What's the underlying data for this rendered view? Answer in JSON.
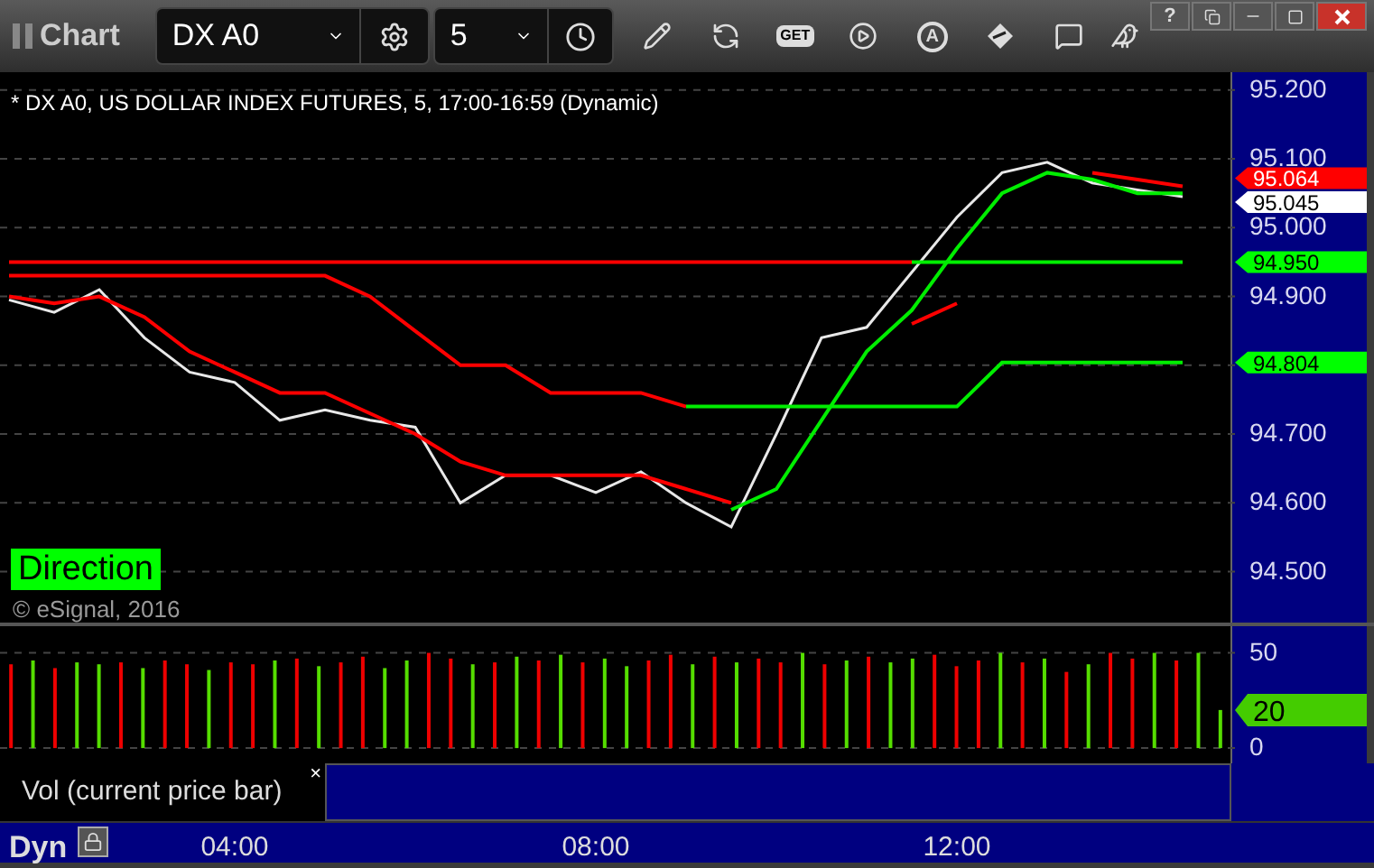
{
  "window": {
    "title": "Chart",
    "help": "?"
  },
  "toolbar": {
    "symbol": "DX A0",
    "interval": "5",
    "get_label": "GET",
    "alert_label": "A"
  },
  "chart": {
    "title": "* DX A0, US DOLLAR INDEX FUTURES, 5, 17:00-16:59 (Dynamic)",
    "label": "Direction",
    "copyright": "© eSignal, 2016",
    "chart_data": {
      "type": "line",
      "ylim": [
        94.426,
        95.226
      ],
      "yticks": [
        {
          "value": 95.2,
          "label": "95.200"
        },
        {
          "value": 95.1,
          "label": "95.100"
        },
        {
          "value": 95.0,
          "label": "95.000"
        },
        {
          "value": 94.9,
          "label": "94.900"
        },
        {
          "value": 94.7,
          "label": "94.700"
        },
        {
          "value": 94.6,
          "label": "94.600"
        },
        {
          "value": 94.5,
          "label": "94.500"
        }
      ],
      "series": [
        {
          "color": "#e8e8e8",
          "values": [
            94.895,
            94.877,
            94.91,
            94.84,
            94.79,
            94.775,
            94.72,
            94.735,
            94.72,
            94.71,
            94.6,
            94.64,
            94.64,
            94.615,
            94.645,
            94.6,
            94.565,
            94.7,
            94.84,
            94.855,
            94.935,
            95.015,
            95.08,
            95.095,
            95.065,
            95.055,
            95.045
          ]
        },
        {
          "color": "#ff0000",
          "values": [
            94.9,
            94.89,
            94.9,
            94.87,
            94.82,
            94.79,
            94.76,
            94.76,
            94.73,
            94.7,
            94.66,
            94.64,
            94.64,
            94.64,
            94.64,
            94.62,
            94.6,
            null,
            null,
            null,
            94.86,
            94.89,
            null,
            null,
            95.08,
            95.07,
            95.06
          ]
        },
        {
          "color": "#00ee00",
          "values": [
            null,
            null,
            null,
            null,
            null,
            null,
            null,
            null,
            null,
            null,
            null,
            null,
            null,
            null,
            null,
            null,
            94.59,
            94.62,
            94.72,
            94.82,
            94.88,
            94.97,
            95.05,
            95.08,
            95.07,
            95.05,
            95.05
          ]
        },
        {
          "color": "#ff0000",
          "values": [
            94.93,
            94.93,
            94.93,
            94.93,
            94.93,
            94.93,
            94.93,
            94.93,
            94.9,
            94.85,
            94.8,
            94.8,
            94.76,
            94.76,
            94.76,
            94.74,
            null,
            null,
            null,
            null,
            null,
            null,
            null,
            null,
            null,
            null,
            null
          ]
        },
        {
          "color": "#ff0000",
          "values": [
            94.95,
            94.95,
            94.95,
            94.95,
            94.95,
            94.95,
            94.95,
            94.95,
            94.95,
            94.95,
            94.95,
            94.95,
            94.95,
            94.95,
            94.95,
            94.95,
            94.95,
            94.95,
            94.95,
            94.95,
            94.95,
            null,
            null,
            null,
            null,
            null,
            null
          ]
        },
        {
          "color": "#00ee00",
          "values": [
            null,
            null,
            null,
            null,
            null,
            null,
            null,
            null,
            null,
            null,
            null,
            null,
            null,
            null,
            null,
            null,
            null,
            null,
            null,
            null,
            94.95,
            94.95,
            94.95,
            94.95,
            94.95,
            94.95,
            94.95
          ]
        },
        {
          "color": "#00ee00",
          "values": [
            null,
            null,
            null,
            null,
            null,
            null,
            null,
            null,
            null,
            null,
            null,
            null,
            null,
            null,
            null,
            94.74,
            94.74,
            94.74,
            94.74,
            94.74,
            94.74,
            94.74,
            94.804,
            94.804,
            94.804,
            94.804,
            94.804
          ]
        }
      ],
      "grid": true,
      "annotations": [
        "95.064",
        "95.045",
        "94.950",
        "94.804"
      ]
    },
    "tags": [
      {
        "color": "#ff0000"
      },
      {
        "color": "#ffffff"
      },
      {
        "color": "#00ff00"
      },
      {
        "color": "#00ff00"
      }
    ]
  },
  "volume": {
    "label": "Vol (current price bar)",
    "close": "×",
    "chart_data": {
      "type": "bar",
      "ylim": [
        -8,
        64
      ],
      "yticks": [
        {
          "value": 50,
          "label": "50"
        },
        {
          "value": 0,
          "label": "0"
        }
      ],
      "series": [
        {
          "color": "#55dd00",
          "values": [
            null,
            46,
            null,
            45,
            44,
            null,
            42,
            null,
            null,
            41,
            null,
            null,
            46,
            null,
            43,
            null,
            null,
            42,
            46,
            null,
            null,
            44,
            null,
            48,
            null,
            49,
            null,
            47,
            43,
            null,
            null,
            44,
            null,
            45,
            null,
            null,
            50,
            null,
            46,
            null,
            45,
            47,
            null,
            null,
            null,
            50,
            null,
            47,
            null,
            44,
            null,
            null,
            50,
            null,
            50,
            20
          ]
        },
        {
          "color": "#ee0000",
          "values": [
            44,
            null,
            42,
            null,
            null,
            45,
            null,
            46,
            44,
            null,
            45,
            44,
            null,
            47,
            null,
            45,
            48,
            null,
            null,
            50,
            47,
            null,
            45,
            null,
            46,
            null,
            45,
            null,
            null,
            46,
            49,
            null,
            48,
            null,
            47,
            45,
            null,
            44,
            null,
            48,
            null,
            null,
            49,
            43,
            46,
            null,
            45,
            null,
            40,
            null,
            50,
            47,
            null,
            46,
            null,
            null
          ]
        }
      ],
      "grid": true,
      "annotations": [
        "20"
      ]
    },
    "tags": [
      {
        "color": "#44cc00"
      }
    ]
  },
  "footer": {
    "mode": "Dyn",
    "times": [
      "04:00",
      "08:00",
      "12:00"
    ]
  }
}
